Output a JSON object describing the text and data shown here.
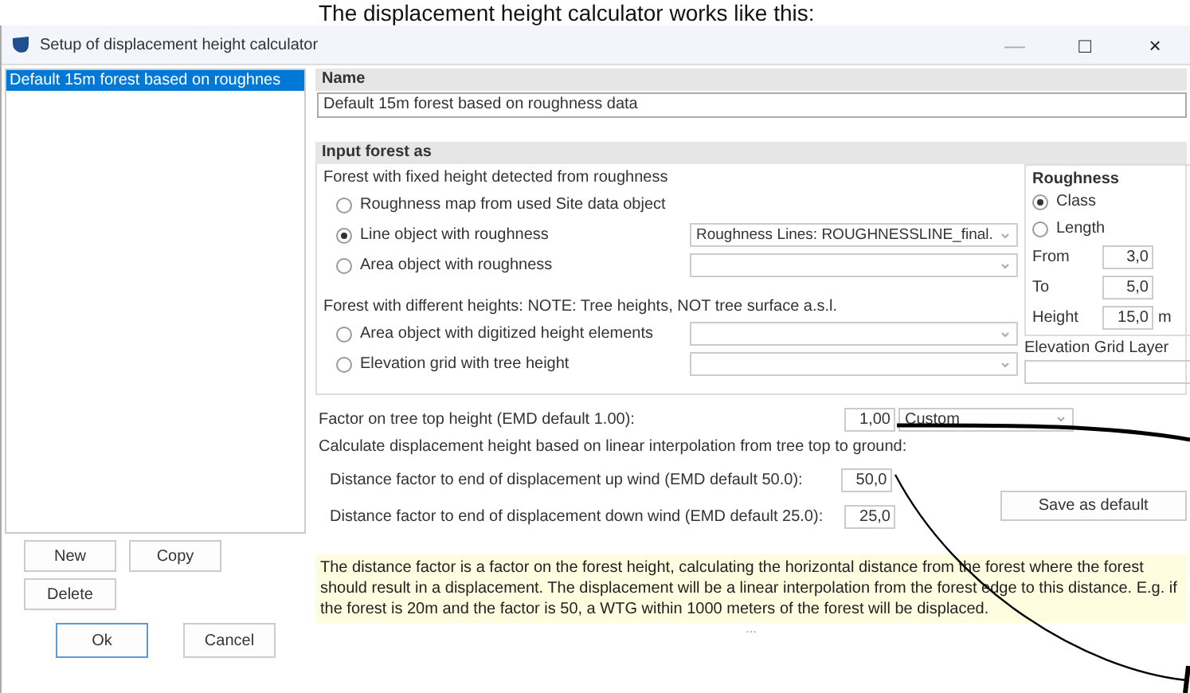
{
  "heading": "The displacement height calculator works like this:",
  "window": {
    "title": "Setup of displacement height calculator",
    "controls": [
      "—",
      "□",
      "×"
    ]
  },
  "calculators": [
    {
      "label": "Default 15m forest based on roughnes",
      "selected": true
    }
  ],
  "list_buttons": [
    "New",
    "Copy",
    "Delete"
  ],
  "name_section": {
    "header": "Name",
    "value": "Default 15m forest based on roughness data"
  },
  "input_forest": {
    "header": "Input forest as",
    "fixed_caption": "Forest with fixed height detected from roughness",
    "fixed_options": [
      {
        "label": "Roughness map from used Site data object",
        "selected": false,
        "kind": "radio"
      },
      {
        "label": "Line object with roughness",
        "selected": true,
        "kind": "radio_combo",
        "combo": "Roughness Lines: ROUGHNESSLINE_final."
      },
      {
        "label": "Area object with roughness",
        "selected": false,
        "kind": "radio_combo"
      }
    ],
    "varied_caption": "Forest with different heights: NOTE: Tree heights, NOT tree surface a.s.l.",
    "varied_options": [
      {
        "label": "Area object with digitized height elements",
        "selected": false,
        "kind": "radio_combo"
      },
      {
        "label": "Elevation grid with tree height",
        "selected": false,
        "kind": "radio_combo"
      }
    ]
  },
  "roughness": {
    "header": "Roughness",
    "modes": [
      {
        "label": "Class",
        "selected": true
      },
      {
        "label": "Length",
        "selected": false
      }
    ],
    "fields": [
      {
        "label": "From",
        "value": "3,0"
      },
      {
        "label": "To",
        "value": "5,0"
      },
      {
        "label": "Height",
        "value": "15,0",
        "unit": "m"
      }
    ]
  },
  "elevation_grid_layer": {
    "label": "Elevation Grid Layer"
  },
  "factor": {
    "label": "Factor on tree top height (EMD default 1.00):",
    "value": "1,00",
    "preset": "Custom"
  },
  "interp_caption": "Calculate displacement height based on linear interpolation from tree top to ground:",
  "distance_factors": [
    {
      "label": "Distance factor to end of displacement up wind (EMD default 50.0):",
      "value": "50,0"
    },
    {
      "label": "Distance factor to end of displacement down wind (EMD default 25.0):",
      "value": "25,0"
    }
  ],
  "save_default": "Save as default",
  "note": "The distance factor is a factor on the forest height, calculating the horizontal distance from the forest where the forest should result in a displacement. The displacement will be a linear interpolation from the forest edge to this distance. E.g. if the forest is 20m and the factor is 50, a WTG within 1000 meters of the forest will be displaced.",
  "grip": "...",
  "dialog_buttons": [
    {
      "label": "Ok",
      "default": true
    },
    {
      "label": "Cancel",
      "default": false
    }
  ]
}
